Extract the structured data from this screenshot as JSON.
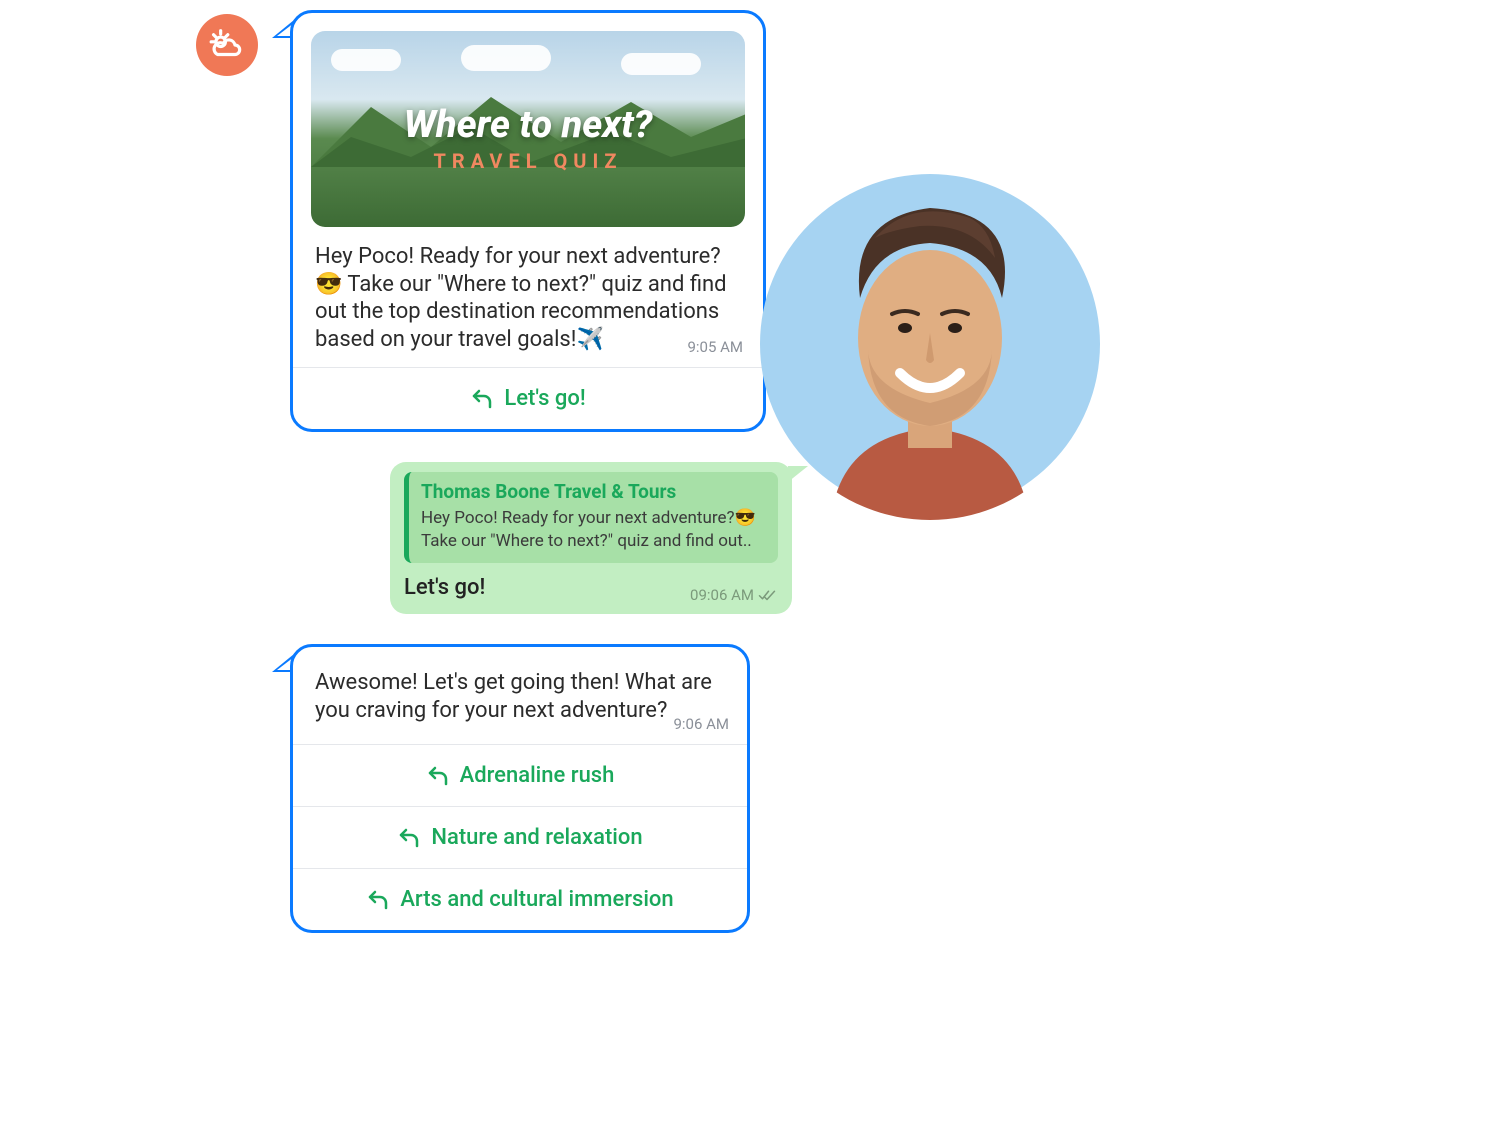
{
  "bot_avatar": {
    "icon": "weather-sun-cloud-icon"
  },
  "msg1": {
    "hero": {
      "title": "Where to next?",
      "subtitle": "TRAVEL QUIZ"
    },
    "text": "Hey Poco! Ready for your next adventure?😎 Take our \"Where to next?\" quiz and find out the top destination recommendations based on your travel goals!✈️",
    "time": "9:05 AM",
    "reply_label": "Let's go!"
  },
  "msg2": {
    "quote": {
      "name": "Thomas Boone Travel & Tours",
      "text": "Hey Poco! Ready for your next adventure?😎 Take our \"Where to next?\" quiz and find out.."
    },
    "text": "Let's go!",
    "time": "09:06 AM"
  },
  "msg3": {
    "text": "Awesome! Let's get going then! What are you craving for your next adventure?",
    "time": "9:06 AM",
    "options": [
      "Adrenaline rush",
      "Nature and relaxation",
      "Arts and cultural immersion"
    ]
  }
}
